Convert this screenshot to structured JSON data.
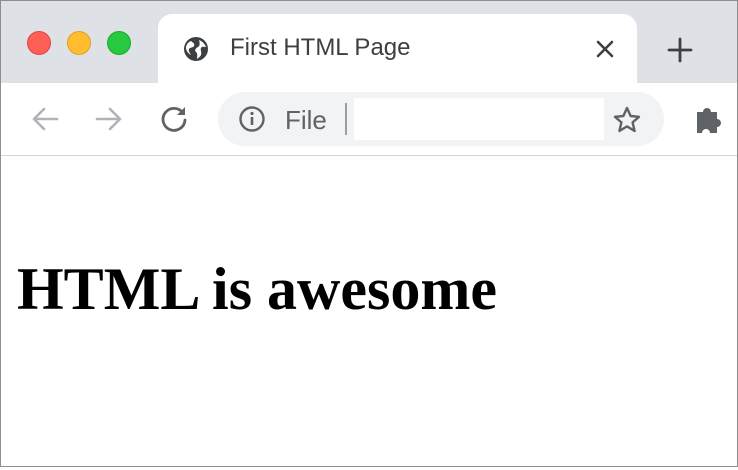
{
  "window": {
    "traffic_lights": {
      "close_color": "#fe5f57",
      "minimize_color": "#febc2e",
      "zoom_color": "#28c840"
    }
  },
  "tab": {
    "favicon": "globe-icon",
    "title": "First HTML Page",
    "close_icon": "close-icon"
  },
  "new_tab_icon": "plus-icon",
  "toolbar": {
    "back_icon": "arrow-left-icon",
    "forward_icon": "arrow-right-icon",
    "reload_icon": "reload-icon",
    "omnibox": {
      "info_icon": "info-icon",
      "scheme_label": "File",
      "url_value": "",
      "bookmark_icon": "star-outline-icon"
    },
    "extensions_icon": "puzzle-icon"
  },
  "page": {
    "heading": "HTML is awesome"
  },
  "colors": {
    "tabstrip_bg": "#dee1e6",
    "omnibox_bg": "#f1f3f4",
    "icon_gray": "#5f6368",
    "disabled_gray": "#b0b3b8"
  }
}
